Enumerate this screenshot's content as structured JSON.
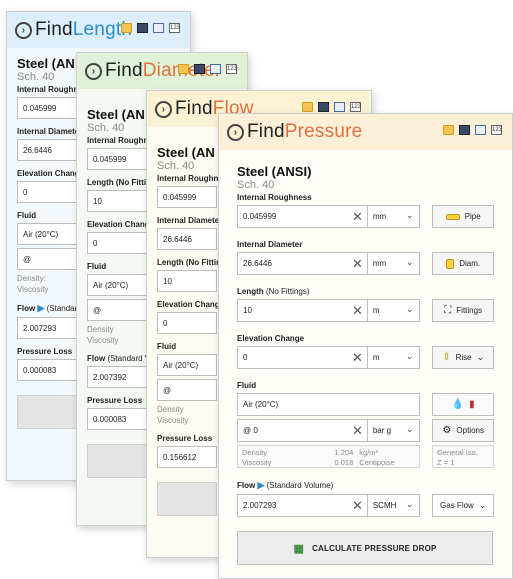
{
  "logo_prefix": "Find",
  "windows": [
    {
      "name": "Length",
      "material": "Steel (AN",
      "schedule": "Sch. 40",
      "labels": [
        "Internal Roughness",
        "Internal Diameter",
        "Elevation Change",
        "Fluid",
        "Flow",
        "Pressure Loss"
      ],
      "flow_label_suffix": "(Standard Volume)",
      "values": {
        "roughness": "0.045999",
        "diameter": "26.6446",
        "elevation": "0",
        "fluid": "Air (20°C)",
        "pressure": "@",
        "flow": "2.007293",
        "result": "0.000083"
      },
      "density_label": "Density:",
      "viscosity_label": "Viscosity"
    },
    {
      "name": "Diameter",
      "material": "Steel (AN",
      "schedule": "Sch. 40",
      "labels": [
        "Internal Roughness",
        "Length (No Fittings)",
        "Elevation Change",
        "Fluid",
        "Flow",
        "Pressure Loss"
      ],
      "flow_label_suffix": "(Standard Volume)",
      "values": {
        "roughness": "0.045999",
        "length": "10",
        "elevation": "0",
        "fluid": "Air (20°C)",
        "pressure": "@",
        "flow": "2.007392",
        "result": "0.000083"
      },
      "density_label": "Density",
      "viscosity_label": "Viscosity"
    },
    {
      "name": "Flow",
      "material": "Steel (AN",
      "schedule": "Sch. 40",
      "labels": [
        "Internal Roughness",
        "Internal Diameter",
        "Length (No Fittings)",
        "Elevation Change",
        "Fluid",
        "Pressure Loss"
      ],
      "values": {
        "roughness": "0.045999",
        "diameter": "26.6446",
        "length": "10",
        "elevation": "0",
        "fluid": "Air (20°C)",
        "pressure": "@",
        "result": "0.156612"
      },
      "density_label": "Density",
      "viscosity_label": "Viscosity"
    }
  ],
  "front": {
    "name": "Pressure",
    "material": "Steel (ANSI)",
    "schedule": "Sch. 40",
    "roughness": {
      "label": "Internal Roughness",
      "value": "0.045999",
      "unit": "mm",
      "button": "Pipe"
    },
    "diameter": {
      "label": "Internal Diameter",
      "value": "26.6446",
      "unit": "mm",
      "button": "Diam."
    },
    "length": {
      "label": "Length",
      "label_suffix": "(No Fittings)",
      "value": "10",
      "unit": "m",
      "button": "Fittings"
    },
    "elevation": {
      "label": "Elevation Change",
      "value": "0",
      "unit": "m",
      "button": "Rise"
    },
    "fluid": {
      "label": "Fluid",
      "value": "Air (20°C)",
      "pressure": "@ 0",
      "pressure_unit": "bar g",
      "density_label": "Density",
      "density_value": "1.204",
      "density_unit": "kg/m³",
      "viscosity_label": "Viscosity",
      "viscosity_value": "0.018",
      "viscosity_unit": "Centipoise",
      "options_label": "Options",
      "model_line1": "General Iso.",
      "model_line2": "Z = 1"
    },
    "flow": {
      "label": "Flow",
      "label_suffix": "(Standard Volume)",
      "value": "2.007293",
      "unit": "SCMH",
      "type": "Gas Flow"
    },
    "calculate_label": "CALCULATE PRESSURE DROP"
  },
  "toolbar_calc_text": "123",
  "accent_color": "#e0703c",
  "blue_accent": "#2a8bc9"
}
